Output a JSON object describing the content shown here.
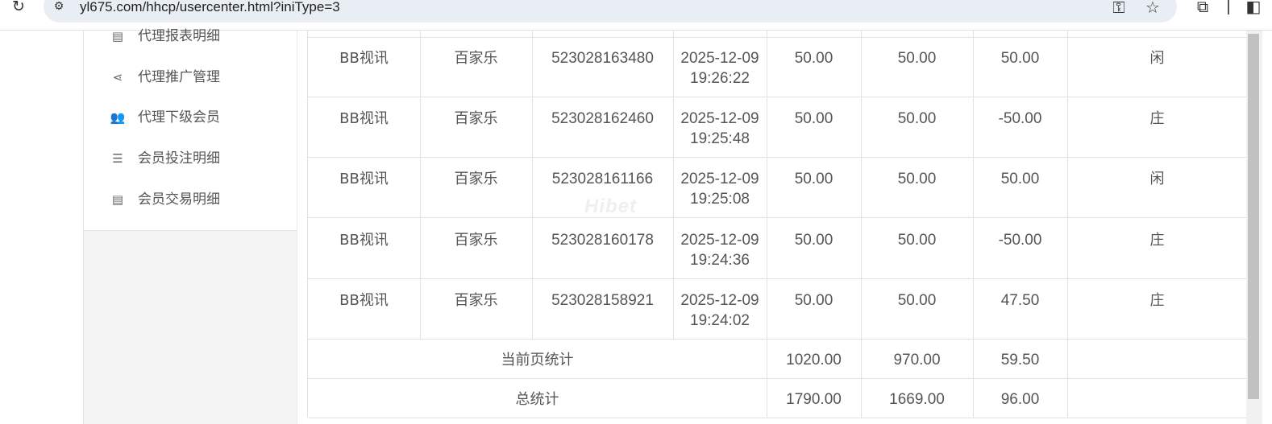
{
  "browser": {
    "url": "yl675.com/hhcp/usercenter.html?iniType=3",
    "icons": [
      "reload-icon",
      "site-settings-icon",
      "password-key-icon",
      "bookmark-star-icon",
      "extensions-icon",
      "side-panel-icon"
    ]
  },
  "sidebar": {
    "items": [
      {
        "label": "代理报表明细",
        "icon": "report-icon"
      },
      {
        "label": "代理推广管理",
        "icon": "share-icon"
      },
      {
        "label": "代理下级会员",
        "icon": "users-icon"
      },
      {
        "label": "会员投注明细",
        "icon": "bet-list-icon"
      },
      {
        "label": "会员交易明细",
        "icon": "transaction-list-icon"
      }
    ]
  },
  "table": {
    "rows": [
      {
        "platform": "BB视讯",
        "game": "百家乐",
        "order_no": "523028163480",
        "date": "2025-12-09",
        "time": "19:26:22",
        "bet": "50.00",
        "valid": "50.00",
        "win_loss": "50.00",
        "content": "闲"
      },
      {
        "platform": "BB视讯",
        "game": "百家乐",
        "order_no": "523028162460",
        "date": "2025-12-09",
        "time": "19:25:48",
        "bet": "50.00",
        "valid": "50.00",
        "win_loss": "-50.00",
        "content": "庄"
      },
      {
        "platform": "BB视讯",
        "game": "百家乐",
        "order_no": "523028161166",
        "date": "2025-12-09",
        "time": "19:25:08",
        "bet": "50.00",
        "valid": "50.00",
        "win_loss": "50.00",
        "content": "闲"
      },
      {
        "platform": "BB视讯",
        "game": "百家乐",
        "order_no": "523028160178",
        "date": "2025-12-09",
        "time": "19:24:36",
        "bet": "50.00",
        "valid": "50.00",
        "win_loss": "-50.00",
        "content": "庄"
      },
      {
        "platform": "BB视讯",
        "game": "百家乐",
        "order_no": "523028158921",
        "date": "2025-12-09",
        "time": "19:24:02",
        "bet": "50.00",
        "valid": "50.00",
        "win_loss": "47.50",
        "content": "庄"
      }
    ],
    "page_summary": {
      "label": "当前页统计",
      "bet": "1020.00",
      "valid": "970.00",
      "win_loss": "59.50"
    },
    "total_summary": {
      "label": "总统计",
      "bet": "1790.00",
      "valid": "1669.00",
      "win_loss": "96.00"
    }
  },
  "watermark": "Hibet"
}
